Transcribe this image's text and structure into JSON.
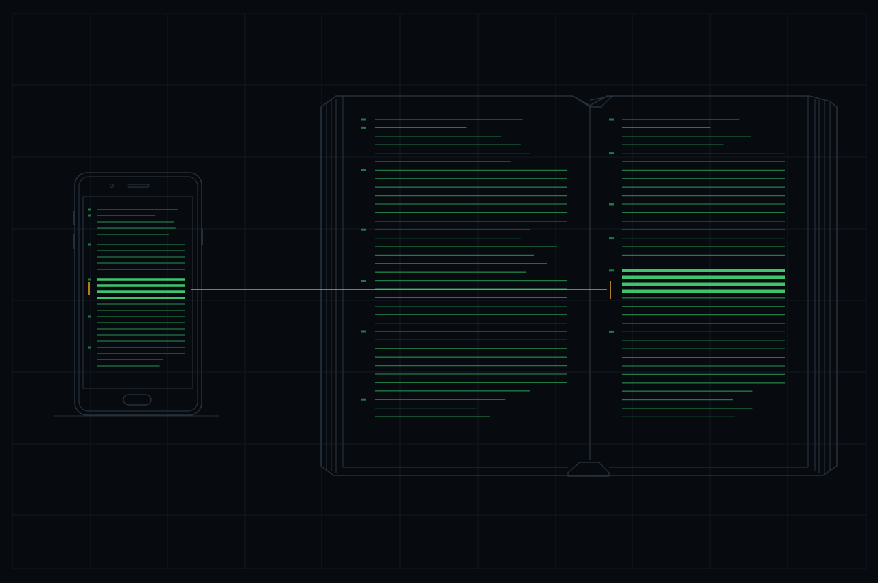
{
  "colors": {
    "background": "#070a0e",
    "grid": "#121921",
    "outline": "#26303b",
    "text_line": "#1f7a45",
    "text_marker": "#1f7a45",
    "highlight": "#3ec46d",
    "connector": "#d99a2b"
  },
  "icons": {
    "phone": "smartphone-icon",
    "book": "open-book-icon",
    "cursor": "text-cursor-icon"
  },
  "phone": {
    "lines": [
      [
        1,
        0.92
      ],
      [
        1,
        0.66
      ],
      [
        0,
        0.87
      ],
      [
        0,
        0.89
      ],
      [
        0,
        0.82
      ],
      [
        2,
        1
      ],
      [
        0,
        1
      ],
      [
        0,
        1
      ],
      [
        0,
        1
      ],
      [
        0,
        1
      ],
      [
        3,
        1
      ],
      [
        0,
        1
      ],
      [
        0,
        1
      ],
      [
        0,
        1
      ],
      [
        0,
        1
      ],
      [
        0,
        1
      ],
      [
        1,
        1
      ],
      [
        0,
        1
      ],
      [
        0,
        1
      ],
      [
        0,
        1
      ],
      [
        0,
        1
      ],
      [
        1,
        1
      ],
      [
        0,
        1
      ],
      [
        0,
        0.75
      ],
      [
        0,
        0.71
      ]
    ]
  },
  "book": {
    "left_page": {
      "lines": [
        [
          1,
          0.77
        ],
        [
          1,
          0.48
        ],
        [
          0,
          0.66
        ],
        [
          0,
          0.76
        ],
        [
          0,
          0.81
        ],
        [
          0,
          0.71
        ],
        [
          1,
          1
        ],
        [
          0,
          1
        ],
        [
          0,
          1
        ],
        [
          0,
          1
        ],
        [
          0,
          1
        ],
        [
          0,
          1
        ],
        [
          0,
          1
        ],
        [
          1,
          0.81
        ],
        [
          0,
          0.76
        ],
        [
          0,
          0.95
        ],
        [
          0,
          0.83
        ],
        [
          0,
          0.9
        ],
        [
          0,
          0.79
        ],
        [
          1,
          1
        ],
        [
          0,
          1
        ],
        [
          0,
          1
        ],
        [
          0,
          1
        ],
        [
          0,
          1
        ],
        [
          0,
          1
        ],
        [
          1,
          1
        ],
        [
          0,
          1
        ],
        [
          0,
          1
        ],
        [
          0,
          1
        ],
        [
          0,
          1
        ],
        [
          0,
          1
        ],
        [
          0,
          1
        ],
        [
          0,
          0.81
        ],
        [
          1,
          0.68
        ],
        [
          0,
          0.53
        ],
        [
          0,
          0.6
        ]
      ]
    },
    "right_page": {
      "lines": [
        [
          1,
          0.72
        ],
        [
          0,
          0.54
        ],
        [
          0,
          0.79
        ],
        [
          0,
          0.62
        ],
        [
          1,
          1
        ],
        [
          0,
          1
        ],
        [
          0,
          1
        ],
        [
          0,
          1
        ],
        [
          0,
          1
        ],
        [
          0,
          1
        ],
        [
          1,
          1
        ],
        [
          0,
          1
        ],
        [
          0,
          1
        ],
        [
          0,
          1
        ],
        [
          1,
          1
        ],
        [
          0,
          1
        ],
        [
          0,
          1
        ],
        [
          3,
          1
        ],
        [
          0,
          1
        ],
        [
          0,
          1
        ],
        [
          0,
          1
        ],
        [
          0,
          1
        ],
        [
          0,
          1
        ],
        [
          0,
          1
        ],
        [
          0,
          1
        ],
        [
          1,
          1
        ],
        [
          0,
          1
        ],
        [
          0,
          1
        ],
        [
          0,
          1
        ],
        [
          0,
          1
        ],
        [
          0,
          1
        ],
        [
          0,
          1
        ],
        [
          0,
          0.8
        ],
        [
          0,
          0.68
        ],
        [
          0,
          0.8
        ],
        [
          0,
          0.69
        ]
      ]
    }
  }
}
